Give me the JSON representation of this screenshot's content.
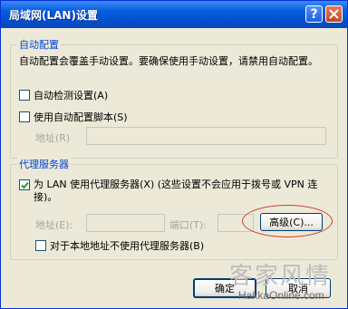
{
  "window": {
    "title": "局域网(LAN)设置"
  },
  "auto_config": {
    "group_label": "自动配置",
    "description": "自动配置会覆盖手动设置。要确保使用手动设置，请禁用自动配置。",
    "auto_detect": {
      "label": "自动检测设置(A)",
      "checked": false
    },
    "use_script": {
      "label": "使用自动配置脚本(S)",
      "checked": false
    },
    "address_label": "地址(R)",
    "address_value": ""
  },
  "proxy": {
    "group_label": "代理服务器",
    "use_proxy": {
      "label": "为 LAN 使用代理服务器(X) (这些设置不会应用于拨号或 VPN 连接)。",
      "checked": true
    },
    "address_label": "地址(E):",
    "address_value": "",
    "port_label": "端口(T):",
    "port_value": "",
    "advanced_label": "高级(C)...",
    "bypass_local": {
      "label": "对于本地地址不使用代理服务器(B)",
      "checked": false
    }
  },
  "buttons": {
    "ok": "确定",
    "cancel": "取消"
  },
  "watermark": {
    "text": "客家风情",
    "site": "HakkaOnline.com"
  }
}
